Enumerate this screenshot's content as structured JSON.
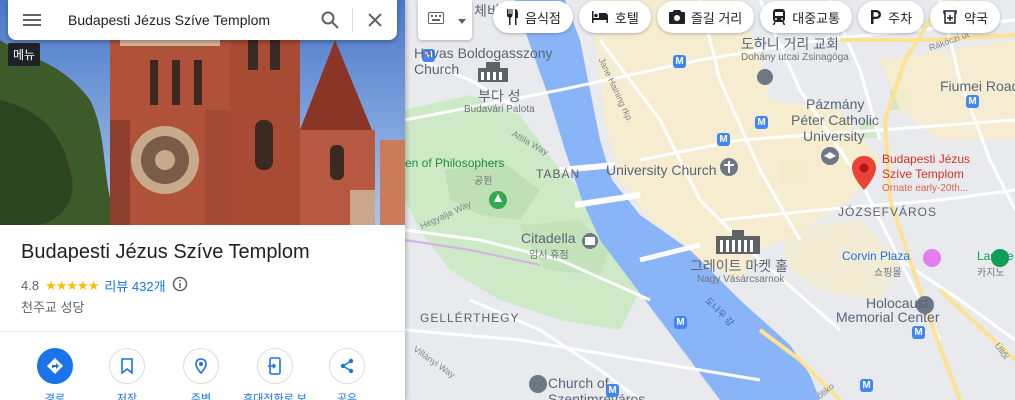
{
  "search": {
    "query": "Budapesti Jézus Szíve Templom",
    "menu_tooltip": "메뉴"
  },
  "place": {
    "name": "Budapesti Jézus Szíve Templom",
    "rating": "4.8",
    "stars": "★★★★★",
    "reviews": "리뷰 432개",
    "category": "천주교 성당"
  },
  "actions": [
    {
      "label": "경로",
      "icon": "directions-icon"
    },
    {
      "label": "저장",
      "icon": "bookmark-icon"
    },
    {
      "label": "주변",
      "icon": "nearby-icon"
    },
    {
      "label": "휴대전화로 보",
      "icon": "send-to-phone-icon"
    },
    {
      "label": "공유",
      "icon": "share-icon"
    }
  ],
  "chips": [
    {
      "label": "음식점",
      "icon": "restaurant-icon"
    },
    {
      "label": "호텔",
      "icon": "hotel-icon"
    },
    {
      "label": "즐길 거리",
      "icon": "camera-icon"
    },
    {
      "label": "대중교통",
      "icon": "transit-icon"
    },
    {
      "label": "주차",
      "icon": "parking-icon"
    },
    {
      "label": "약국",
      "icon": "pharmacy-icon"
    }
  ],
  "map_labels": {
    "havas": "Havas Boldogasszony",
    "church": "Church",
    "chebi": "체비",
    "buda_castle_ko": "부다 성",
    "buda_castle": "Budavári Palota",
    "philosophers": "en of Philosophers",
    "park_ko": "공원",
    "taban": "TABÁN",
    "university_church": "University Church",
    "citadella": "Citadella",
    "citadella_ko": "임시 휴점",
    "great_market_ko": "그레이트 마켓 홀",
    "great_market": "Nagy Vásárcsarnok",
    "gellerthegy": "GELLÉRTHEGY",
    "church_of": "Church of",
    "szentimreváros": "Szentimreváros",
    "dohany_ko": "도하니 거리 교회",
    "dohany": "Dohány utcai Zsinagóga",
    "pazmany1": "Pázmány",
    "pazmany2": "Péter Catholic",
    "pazmany3": "University",
    "fiumei": "Fiumei Road",
    "place_red1": "Budapesti Jézus",
    "place_red2": "Szíve Templom",
    "place_red3": "Ornate early-20th...",
    "jozsefvaros": "JÓZSEFVÁROS",
    "corvin": "Corvin Plaza",
    "corvin_ko": "쇼핑몰",
    "lasve": "Las Ve",
    "lasve_ko": "카지노",
    "holocaust1": "Holocaust",
    "holocaust2": "Memorial Center",
    "danube_ko": "도나우 강",
    "rakoczi": "Rákóczi út",
    "ulloi": "Üllői",
    "jane_haining": "Jane Haining rkp.",
    "attila": "Attila Way",
    "hegyalja": "Hegyalja Way",
    "szent": "Szent",
    "allanyi": "Villányi Way",
    "sza": "sza",
    "fotiko": "őtiko"
  }
}
